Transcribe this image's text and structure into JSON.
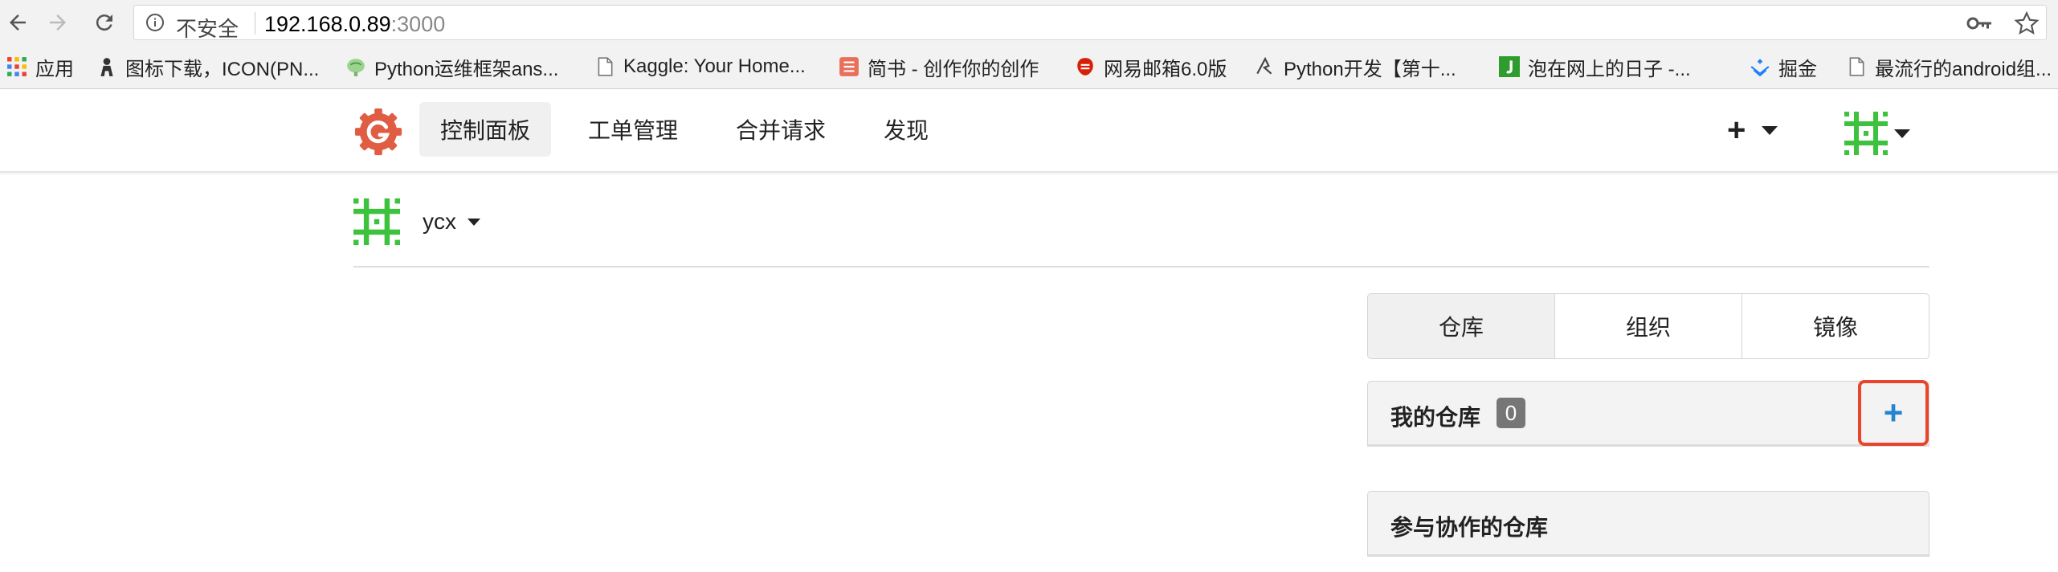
{
  "browser": {
    "security_label": "不安全",
    "url_host": "192.168.0.89",
    "url_port": ":3000",
    "bookmarks": [
      {
        "label": "应用",
        "icon": "apps-grid-icon"
      },
      {
        "label": "图标下载，ICON(PN...",
        "icon": "person-icon"
      },
      {
        "label": "Python运维框架ans...",
        "icon": "brain-icon"
      },
      {
        "label": "Kaggle: Your Home...",
        "icon": "page-icon"
      },
      {
        "label": "简书 - 创作你的创作",
        "icon": "jianshu-icon"
      },
      {
        "label": "网易邮箱6.0版",
        "icon": "netease-icon"
      },
      {
        "label": "Python开发【第十...",
        "icon": "wing-icon"
      },
      {
        "label": "泡在网上的日子 -...",
        "icon": "j-icon"
      },
      {
        "label": "掘金",
        "icon": "juejin-icon"
      },
      {
        "label": "最流行的android组...",
        "icon": "page-icon"
      }
    ]
  },
  "header": {
    "nav": [
      "控制面板",
      "工单管理",
      "合并请求",
      "发现"
    ],
    "plus_label": "+"
  },
  "context": {
    "username": "ycx"
  },
  "tabs": [
    "仓库",
    "组织",
    "镜像"
  ],
  "my_repos": {
    "title": "我的仓库",
    "count": "0",
    "add_label": "+"
  },
  "collab_repos": {
    "title": "参与协作的仓库"
  },
  "colors": {
    "accent_blue": "#2185d0",
    "highlight_red": "#e8452c",
    "avatar_green": "#3cc23c",
    "logo_red": "#e05d44"
  }
}
